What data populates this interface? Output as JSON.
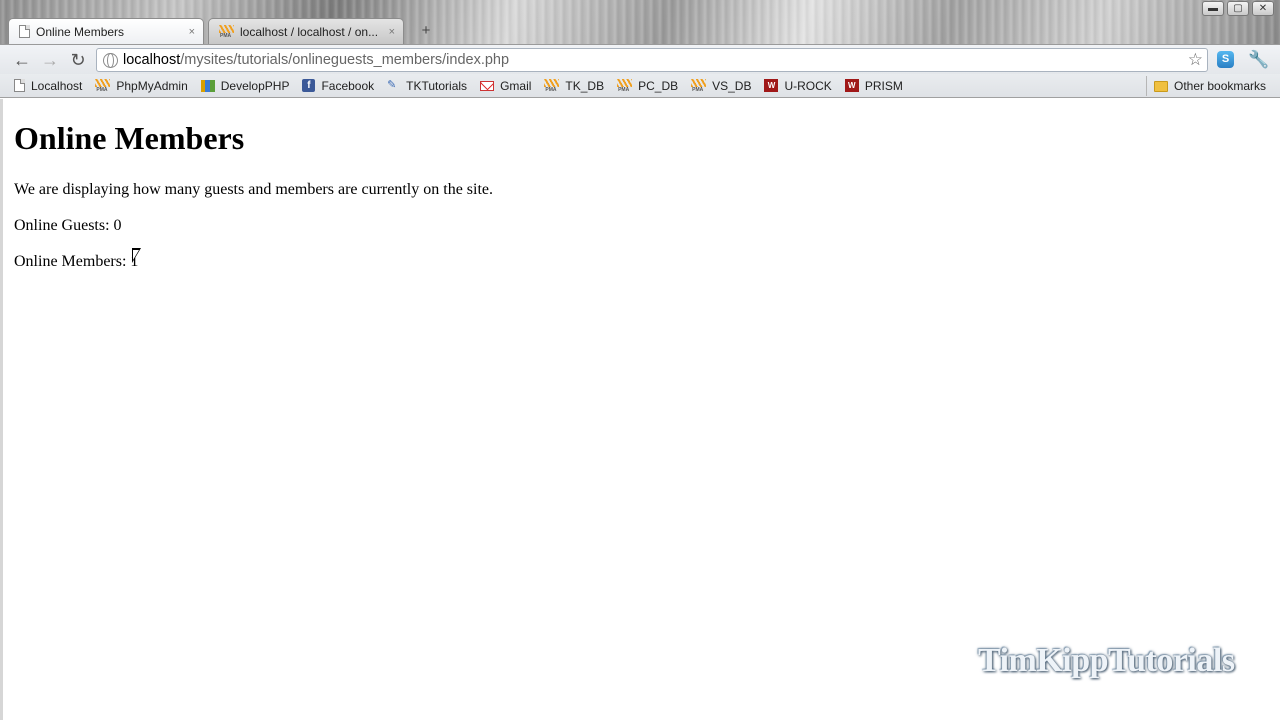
{
  "window": {
    "controls": {
      "minimize": "▬",
      "maximize": "▢",
      "close": "✕"
    }
  },
  "tabs": [
    {
      "title": "Online Members",
      "icon": "page-icon",
      "active": true,
      "close": "×"
    },
    {
      "title": "localhost / localhost / on...",
      "icon": "pma-icon",
      "active": false,
      "close": "×"
    }
  ],
  "new_tab": "+",
  "toolbar": {
    "back": "←",
    "forward": "→",
    "reload": "↻",
    "url_host": "localhost",
    "url_path": "/mysites/tutorials/onlineguests_members/index.php",
    "star": "☆",
    "ext": "S",
    "wrench": "🔧"
  },
  "bookmarks": [
    {
      "label": "Localhost",
      "icon": "page-icon"
    },
    {
      "label": "PhpMyAdmin",
      "icon": "pma-icon"
    },
    {
      "label": "DevelopPHP",
      "icon": "developphp-icon"
    },
    {
      "label": "Facebook",
      "icon": "facebook-icon"
    },
    {
      "label": "TKTutorials",
      "icon": "tk-icon"
    },
    {
      "label": "Gmail",
      "icon": "gmail-icon"
    },
    {
      "label": "TK_DB",
      "icon": "pma-icon"
    },
    {
      "label": "PC_DB",
      "icon": "pma-icon"
    },
    {
      "label": "VS_DB",
      "icon": "pma-icon"
    },
    {
      "label": "U-ROCK",
      "icon": "urock-icon"
    },
    {
      "label": "PRISM",
      "icon": "urock-icon"
    }
  ],
  "other_bookmarks": "Other bookmarks",
  "page": {
    "heading": "Online Members",
    "intro": "We are displaying how many guests and members are currently on the site.",
    "guests_line": "Online Guests: 0",
    "members_line": "Online Members: 1"
  },
  "watermark": "TimKippTutorials"
}
